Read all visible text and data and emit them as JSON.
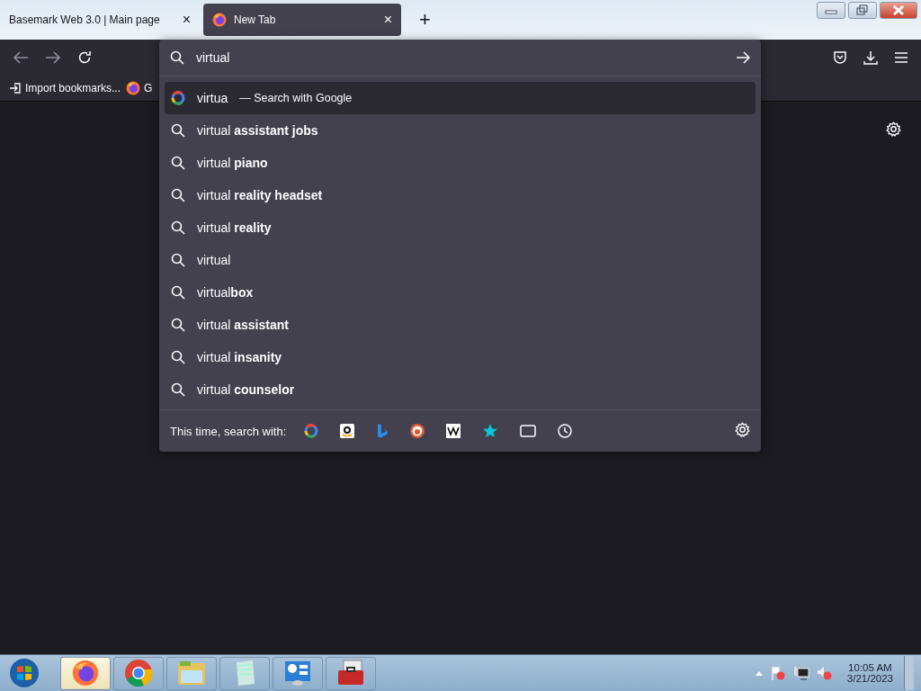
{
  "tabs": [
    {
      "title": "Basemark Web 3.0 | Main page",
      "selected": false,
      "close": "×"
    },
    {
      "title": "New Tab",
      "selected": true,
      "close": "×"
    }
  ],
  "new_tab": "+",
  "bookmarks": [
    {
      "label": "Import bookmarks...",
      "kind": "import"
    },
    {
      "label": "G",
      "kind": "firefox"
    }
  ],
  "address_bar": {
    "value": "virtual"
  },
  "suggestions": [
    {
      "kind": "engine",
      "text": "virtua",
      "action": "— Search with Google",
      "selected": true
    },
    {
      "kind": "search",
      "text": "virtual **assistant jobs**",
      "selected": false
    },
    {
      "kind": "search",
      "text": "virtual **piano**",
      "selected": false
    },
    {
      "kind": "search",
      "text": "virtual **reality headset**",
      "selected": false
    },
    {
      "kind": "search",
      "text": "virtual **reality**",
      "selected": false
    },
    {
      "kind": "search",
      "text": "virtual",
      "selected": false
    },
    {
      "kind": "search",
      "text": "virtual**box**",
      "selected": false
    },
    {
      "kind": "search",
      "text": "virtual **assistant**",
      "selected": false
    },
    {
      "kind": "search",
      "text": "virtual **insanity**",
      "selected": false
    },
    {
      "kind": "search",
      "text": "virtual **counselor**",
      "selected": false
    }
  ],
  "search_with": {
    "label": "This time, search with:"
  },
  "taskbar": {
    "apps": [
      {
        "kind": "firefox",
        "selected": true
      },
      {
        "kind": "chrome",
        "selected": false
      },
      {
        "kind": "explorer",
        "selected": false
      },
      {
        "kind": "notepad",
        "selected": false
      },
      {
        "kind": "control",
        "selected": false
      },
      {
        "kind": "toolbox",
        "selected": false
      }
    ],
    "time": "10:05 AM",
    "date": "3/21/2023"
  }
}
